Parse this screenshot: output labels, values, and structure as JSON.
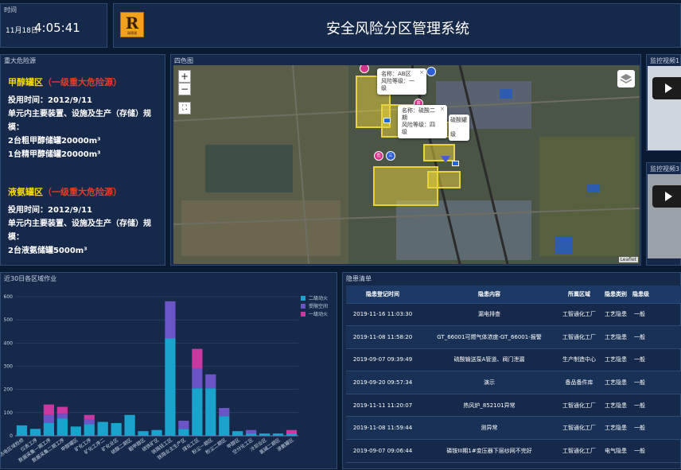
{
  "time_panel": {
    "title": "时间",
    "date": "11月18日",
    "clock": "4:05:41"
  },
  "header": {
    "title": "安全风险分区管理系统",
    "logo_letter": "R",
    "logo_sub": "瑞锦通"
  },
  "hazard_panel": {
    "title": "重大危险源",
    "sources": [
      {
        "name": "甲醇罐区",
        "level": "（一级重大危险源）",
        "lines": [
          "投用时间：2012/9/11",
          "单元内主要装置、设施及生产（存储）规模：",
          "2台粗甲醇储罐20000m³",
          "1台精甲醇储罐20000m³"
        ]
      },
      {
        "name": "液氨罐区",
        "level": "（一级重大危险源）",
        "lines": [
          "投用时间：2012/9/11",
          "单元内主要装置、设施及生产（存储）规模：",
          "2台液氨储罐5000m³"
        ]
      }
    ]
  },
  "map_panel": {
    "title": "四色图",
    "zoom_in": "+",
    "zoom_out": "−",
    "fullscreen": "⛶",
    "popups": [
      {
        "lines": [
          "名称：AB区",
          "风险等级：一",
          "级"
        ],
        "close": "×"
      },
      {
        "lines": [
          "名称：硫酸二",
          "期",
          "风险等级：四",
          "级"
        ],
        "close": "×"
      }
    ],
    "partial_labels": [
      "硫酸罐",
      "级"
    ],
    "pins": [
      "危",
      "高",
      "三"
    ],
    "attribution": "Leaflet"
  },
  "video1": {
    "title": "监控视频1"
  },
  "video3": {
    "title": "监控视频3"
  },
  "chart_panel": {
    "title": "近30日各区域作业"
  },
  "chart_data": {
    "type": "bar",
    "stacked": true,
    "ylim": [
      0,
      600
    ],
    "yticks": [
      0,
      100,
      200,
      300,
      400,
      500,
      600
    ],
    "categories": [
      "热电区域检修",
      "仪表工序",
      "数据采集一期工序",
      "数据采集二期工序",
      "甲醇罐区",
      "矿化工序",
      "矿化工序二",
      "矿化业区",
      "硫酸二期区",
      "粗甲醇区",
      "硫铁矿区",
      "铁路轻工区",
      "铁路业主生产区",
      "煤化工区",
      "粉尘一期区",
      "粉尘二期区",
      "甲醇区",
      "空分化工区",
      "冷却业区",
      "氯碱二期区",
      "液氨罐区"
    ],
    "series": [
      {
        "name": "二级动火",
        "color": "#1aa3cc",
        "values": [
          45,
          30,
          55,
          75,
          40,
          50,
          60,
          55,
          90,
          20,
          25,
          420,
          30,
          205,
          205,
          85,
          20,
          10,
          10,
          10,
          10
        ]
      },
      {
        "name": "受限空间",
        "color": "#6b54c6",
        "values": [
          0,
          0,
          35,
          20,
          0,
          20,
          0,
          0,
          0,
          0,
          0,
          160,
          35,
          85,
          60,
          35,
          0,
          15,
          0,
          0,
          0
        ]
      },
      {
        "name": "一级动火",
        "color": "#c8389f",
        "values": [
          0,
          0,
          45,
          30,
          0,
          20,
          0,
          0,
          0,
          0,
          0,
          0,
          0,
          85,
          0,
          0,
          0,
          0,
          0,
          0,
          15
        ]
      }
    ]
  },
  "issues_panel": {
    "title": "隐患清单",
    "columns": [
      "隐患登记时间",
      "隐患内容",
      "所属区域",
      "隐患类别",
      "隐患级"
    ],
    "rows": [
      [
        "2019-11-16 11:03:30",
        "漏电排查",
        "工智通化工厂",
        "工艺隐患",
        "一般"
      ],
      [
        "2019-11-08 11:58:20",
        "GT_66001可燃气体浓度-GT_66001-报警",
        "工智通化工厂",
        "工艺隐患",
        "一般"
      ],
      [
        "2019-09-07 09:39:49",
        "硫酸输送泵A管道、阀门泄漏",
        "生产制造中心",
        "工艺隐患",
        "一般"
      ],
      [
        "2019-09-20 09:57:34",
        "演示",
        "备品备件库",
        "工艺隐患",
        "一般"
      ],
      [
        "2019-11-11 11:20:07",
        "热风炉_852101异常",
        "工智通化工厂",
        "工艺隐患",
        "一般"
      ],
      [
        "2019-11-08 11:59:44",
        "测异常",
        "工智通化工厂",
        "工艺隐患",
        "一般"
      ],
      [
        "2019-09-07 09:06:44",
        "磷铵III期1#变压器下层纱网不完好",
        "工智通化工厂",
        "电气隐患",
        "一般"
      ]
    ]
  }
}
